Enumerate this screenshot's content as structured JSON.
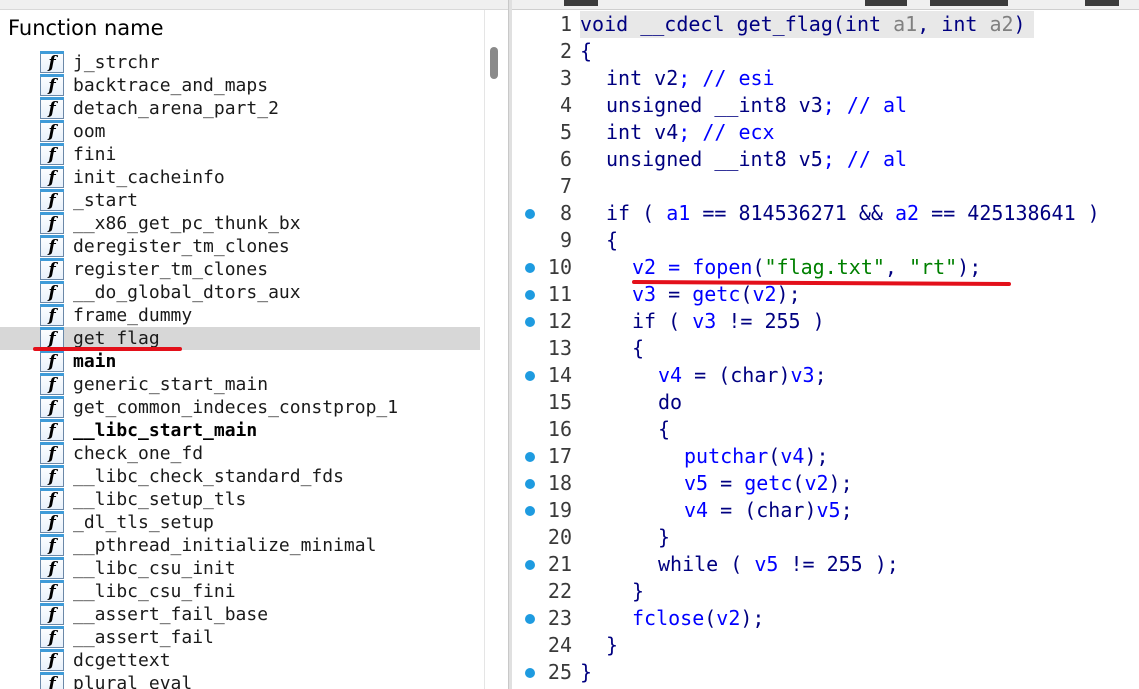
{
  "left_panel": {
    "header": "Function name",
    "icon_glyph": "f",
    "functions": [
      {
        "name": "j_strchr",
        "bold": false,
        "selected": false
      },
      {
        "name": "backtrace_and_maps",
        "bold": false,
        "selected": false
      },
      {
        "name": "detach_arena_part_2",
        "bold": false,
        "selected": false
      },
      {
        "name": "oom",
        "bold": false,
        "selected": false
      },
      {
        "name": "fini",
        "bold": false,
        "selected": false
      },
      {
        "name": "init_cacheinfo",
        "bold": false,
        "selected": false
      },
      {
        "name": "_start",
        "bold": false,
        "selected": false
      },
      {
        "name": "__x86_get_pc_thunk_bx",
        "bold": false,
        "selected": false
      },
      {
        "name": "deregister_tm_clones",
        "bold": false,
        "selected": false
      },
      {
        "name": "register_tm_clones",
        "bold": false,
        "selected": false
      },
      {
        "name": "__do_global_dtors_aux",
        "bold": false,
        "selected": false
      },
      {
        "name": "frame_dummy",
        "bold": false,
        "selected": false
      },
      {
        "name": "get_flag",
        "bold": false,
        "selected": true
      },
      {
        "name": "main",
        "bold": true,
        "selected": false
      },
      {
        "name": "generic_start_main",
        "bold": false,
        "selected": false
      },
      {
        "name": "get_common_indeces_constprop_1",
        "bold": false,
        "selected": false
      },
      {
        "name": "__libc_start_main",
        "bold": true,
        "selected": false
      },
      {
        "name": "check_one_fd",
        "bold": false,
        "selected": false
      },
      {
        "name": "__libc_check_standard_fds",
        "bold": false,
        "selected": false
      },
      {
        "name": "__libc_setup_tls",
        "bold": false,
        "selected": false
      },
      {
        "name": "_dl_tls_setup",
        "bold": false,
        "selected": false
      },
      {
        "name": "__pthread_initialize_minimal",
        "bold": false,
        "selected": false
      },
      {
        "name": "__libc_csu_init",
        "bold": false,
        "selected": false
      },
      {
        "name": "__libc_csu_fini",
        "bold": false,
        "selected": false
      },
      {
        "name": "__assert_fail_base",
        "bold": false,
        "selected": false
      },
      {
        "name": "__assert_fail",
        "bold": false,
        "selected": false
      },
      {
        "name": "dcgettext",
        "bold": false,
        "selected": false
      },
      {
        "name": "plural_eval",
        "bold": false,
        "selected": false
      }
    ]
  },
  "code_view": {
    "lines": [
      {
        "n": "1",
        "bp": false,
        "indent": 0,
        "hl": true,
        "t": [
          [
            "void __cdecl ",
            "ty"
          ],
          [
            "get_flag",
            "k"
          ],
          [
            "(",
            "k"
          ],
          [
            "int ",
            "ty"
          ],
          [
            "a1",
            "vr"
          ],
          [
            ", ",
            "k"
          ],
          [
            "int ",
            "ty"
          ],
          [
            "a2",
            "vr"
          ],
          [
            ")",
            "k"
          ]
        ]
      },
      {
        "n": "2",
        "bp": false,
        "indent": 0,
        "t": [
          [
            "{",
            "k"
          ]
        ]
      },
      {
        "n": "3",
        "bp": false,
        "indent": 1,
        "t": [
          [
            "int ",
            "ty"
          ],
          [
            "v2",
            "k"
          ],
          [
            "; // esi",
            "c1"
          ]
        ]
      },
      {
        "n": "4",
        "bp": false,
        "indent": 1,
        "t": [
          [
            "unsigned __int8 ",
            "ty"
          ],
          [
            "v3",
            "k"
          ],
          [
            "; // al",
            "c1"
          ]
        ]
      },
      {
        "n": "5",
        "bp": false,
        "indent": 1,
        "t": [
          [
            "int ",
            "ty"
          ],
          [
            "v4",
            "k"
          ],
          [
            "; // ecx",
            "c1"
          ]
        ]
      },
      {
        "n": "6",
        "bp": false,
        "indent": 1,
        "t": [
          [
            "unsigned __int8 ",
            "ty"
          ],
          [
            "v5",
            "k"
          ],
          [
            "; // al",
            "c1"
          ]
        ]
      },
      {
        "n": "7",
        "bp": false,
        "indent": 0,
        "t": []
      },
      {
        "n": "8",
        "bp": true,
        "indent": 1,
        "t": [
          [
            "if ( ",
            "k"
          ],
          [
            "a1",
            "c1"
          ],
          [
            " == 814536271 && ",
            "k"
          ],
          [
            "a2",
            "c1"
          ],
          [
            " == 425138641 )",
            "k"
          ]
        ]
      },
      {
        "n": "9",
        "bp": false,
        "indent": 1,
        "t": [
          [
            "{",
            "k"
          ]
        ]
      },
      {
        "n": "10",
        "bp": true,
        "indent": 2,
        "t": [
          [
            "v2",
            "c1"
          ],
          [
            " = ",
            "c1"
          ],
          [
            "fopen",
            "c1"
          ],
          [
            "(",
            "k"
          ],
          [
            "\"flag.txt\"",
            "str"
          ],
          [
            ", ",
            "k"
          ],
          [
            "\"rt\"",
            "str"
          ],
          [
            ");",
            "k"
          ]
        ]
      },
      {
        "n": "11",
        "bp": true,
        "indent": 2,
        "t": [
          [
            "v3",
            "c1"
          ],
          [
            " = ",
            "k"
          ],
          [
            "getc",
            "c1"
          ],
          [
            "(",
            "k"
          ],
          [
            "v2",
            "c1"
          ],
          [
            ");",
            "k"
          ]
        ]
      },
      {
        "n": "12",
        "bp": true,
        "indent": 2,
        "t": [
          [
            "if ( ",
            "k"
          ],
          [
            "v3",
            "c1"
          ],
          [
            " != 255 )",
            "k"
          ]
        ]
      },
      {
        "n": "13",
        "bp": false,
        "indent": 2,
        "t": [
          [
            "{",
            "k"
          ]
        ]
      },
      {
        "n": "14",
        "bp": true,
        "indent": 3,
        "t": [
          [
            "v4",
            "c1"
          ],
          [
            " = (",
            "k"
          ],
          [
            "char",
            "ty"
          ],
          [
            ")",
            "k"
          ],
          [
            "v3",
            "c1"
          ],
          [
            ";",
            "k"
          ]
        ]
      },
      {
        "n": "15",
        "bp": false,
        "indent": 3,
        "t": [
          [
            "do",
            "k"
          ]
        ]
      },
      {
        "n": "16",
        "bp": false,
        "indent": 3,
        "t": [
          [
            "{",
            "k"
          ]
        ]
      },
      {
        "n": "17",
        "bp": true,
        "indent": 4,
        "t": [
          [
            "putchar",
            "c1"
          ],
          [
            "(",
            "k"
          ],
          [
            "v4",
            "c1"
          ],
          [
            ");",
            "k"
          ]
        ]
      },
      {
        "n": "18",
        "bp": true,
        "indent": 4,
        "t": [
          [
            "v5",
            "c1"
          ],
          [
            " = ",
            "k"
          ],
          [
            "getc",
            "c1"
          ],
          [
            "(",
            "k"
          ],
          [
            "v2",
            "c1"
          ],
          [
            ");",
            "k"
          ]
        ]
      },
      {
        "n": "19",
        "bp": true,
        "indent": 4,
        "t": [
          [
            "v4",
            "c1"
          ],
          [
            " = (",
            "k"
          ],
          [
            "char",
            "ty"
          ],
          [
            ")",
            "k"
          ],
          [
            "v5",
            "c1"
          ],
          [
            ";",
            "k"
          ]
        ]
      },
      {
        "n": "20",
        "bp": false,
        "indent": 3,
        "t": [
          [
            "}",
            "k"
          ]
        ]
      },
      {
        "n": "21",
        "bp": true,
        "indent": 3,
        "t": [
          [
            "while ( ",
            "k"
          ],
          [
            "v5",
            "c1"
          ],
          [
            " != 255 );",
            "k"
          ]
        ]
      },
      {
        "n": "22",
        "bp": false,
        "indent": 2,
        "t": [
          [
            "}",
            "k"
          ]
        ]
      },
      {
        "n": "23",
        "bp": true,
        "indent": 2,
        "t": [
          [
            "fclose",
            "c1"
          ],
          [
            "(",
            "k"
          ],
          [
            "v2",
            "c1"
          ],
          [
            ");",
            "k"
          ]
        ]
      },
      {
        "n": "24",
        "bp": false,
        "indent": 1,
        "t": [
          [
            "}",
            "k"
          ]
        ]
      },
      {
        "n": "25",
        "bp": true,
        "indent": 0,
        "t": [
          [
            "}",
            "k"
          ]
        ]
      }
    ]
  },
  "colors": {
    "keyword": "#000080",
    "identifier_blue": "#0000ff",
    "string": "#008000",
    "breakpoint_dot": "#1e9be0",
    "annotation_red": "#e3101a",
    "selected_row": "#d7d7d7"
  }
}
